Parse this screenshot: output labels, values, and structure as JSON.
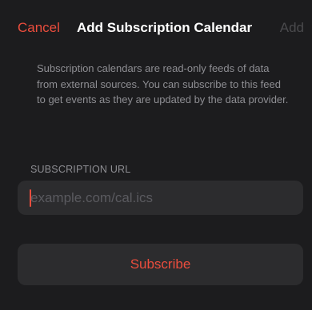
{
  "nav": {
    "cancel_label": "Cancel",
    "title": "Add Subscription Calendar",
    "add_label": "Add"
  },
  "description": "Subscription calendars are read-only feeds of data from external sources. You can subscribe to this feed to get events as they are updated by the data provider.",
  "url_section": {
    "header": "SUBSCRIPTION URL",
    "value": "",
    "placeholder": "example.com/cal.ics"
  },
  "subscribe_label": "Subscribe",
  "colors": {
    "accent": "#eb4d3d",
    "background": "#1c1c1e",
    "card": "#2c2c2e",
    "secondary_text": "#8e8e93",
    "disabled_text": "#4a4a4d"
  }
}
